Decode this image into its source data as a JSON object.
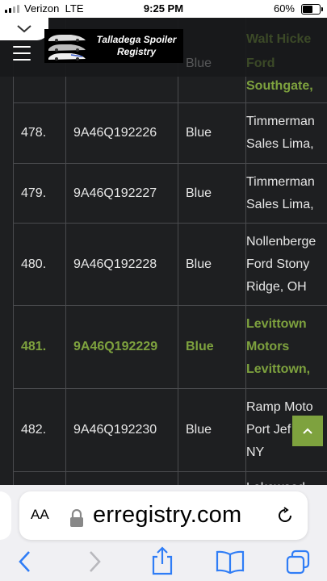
{
  "status_bar": {
    "carrier": "Verizon",
    "network": "LTE",
    "time": "9:25 PM",
    "battery": "60%"
  },
  "header": {
    "logo_line1": "Talladega Spoiler",
    "logo_line2": "Registry",
    "partial_dealer_line1": "Walt Hicke",
    "partial_blue": "Blue",
    "partial_dealer_line2": "Ford"
  },
  "rows": [
    {
      "number": "",
      "vin": "",
      "color": "",
      "dealer": [
        "Southgate,"
      ],
      "highlight": true
    },
    {
      "number": "478.",
      "vin": "9A46Q192226",
      "color": "Blue",
      "dealer": [
        "Timmerman",
        "Sales Lima,"
      ],
      "highlight": false
    },
    {
      "number": "479.",
      "vin": "9A46Q192227",
      "color": "Blue",
      "dealer": [
        "Timmerman",
        "Sales Lima,"
      ],
      "highlight": false
    },
    {
      "number": "480.",
      "vin": "9A46Q192228",
      "color": "Blue",
      "dealer": [
        "Nollenberge",
        "Ford Stony",
        "Ridge, OH"
      ],
      "highlight": false
    },
    {
      "number": "481.",
      "vin": "9A46Q192229",
      "color": "Blue",
      "dealer": [
        "Levittown",
        "Motors",
        "Levittown,"
      ],
      "highlight": true
    },
    {
      "number": "482.",
      "vin": "9A46Q192230",
      "color": "Blue",
      "dealer": [
        "Ramp Moto",
        "Port Jef",
        "NY"
      ],
      "highlight": false
    },
    {
      "number": "",
      "vin": "",
      "color": "",
      "dealer": [
        "Lakewood"
      ],
      "highlight": false
    }
  ],
  "browser": {
    "aa_label": "AA",
    "domain": "erregistry.com"
  },
  "colors": {
    "accent_green": "#7ea23e",
    "background": "#1e1f21",
    "grid": "#4a4b4e"
  },
  "icons": [
    "chevron-down-icon",
    "hamburger-icon",
    "chevron-up-icon",
    "lock-icon",
    "reload-icon",
    "back-icon",
    "forward-icon",
    "share-icon",
    "bookmarks-icon",
    "tabs-icon"
  ]
}
